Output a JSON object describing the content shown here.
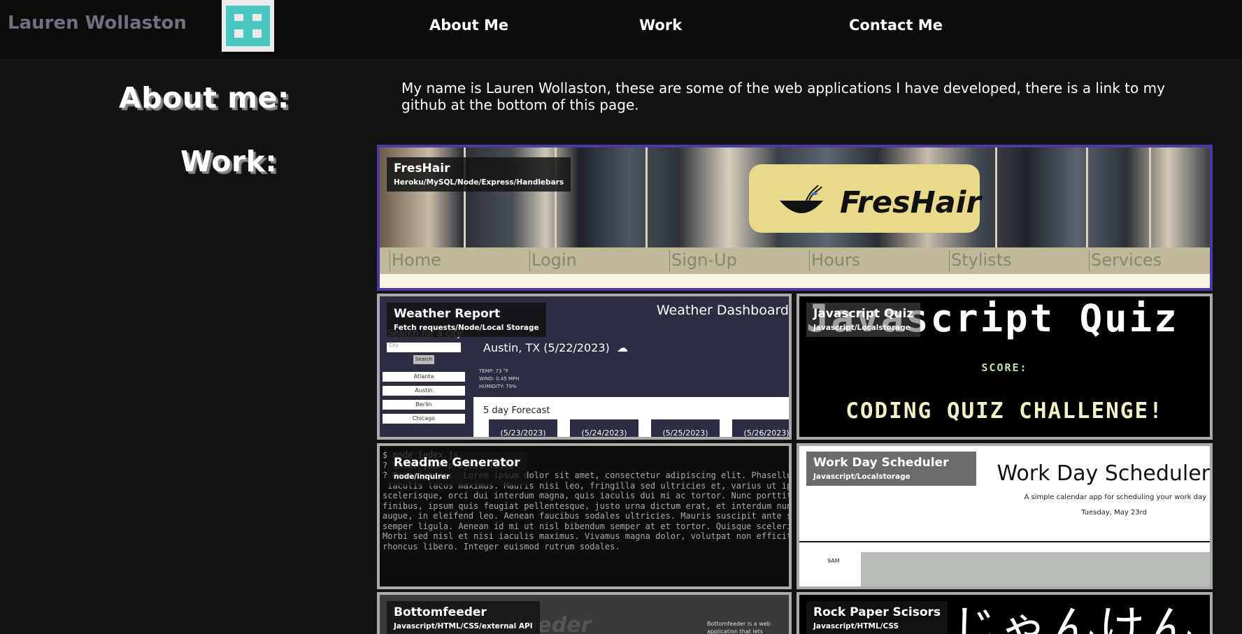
{
  "header": {
    "brand_name": "Lauren Wollaston",
    "nav": [
      {
        "label": "About Me"
      },
      {
        "label": "Work"
      },
      {
        "label": "Contact Me"
      }
    ]
  },
  "about": {
    "heading": "About me:",
    "text": "My name is Lauren Wollaston, these are some of the web applications I have developed, there is a link to my github at the bottom of this page."
  },
  "work": {
    "heading": "Work:",
    "projects": [
      {
        "title": "FresHair",
        "tech": "Heroku/MySQL/Node/Express/Handlebars"
      },
      {
        "title": "Weather Report",
        "tech": "Fetch requests/Node/Local Storage"
      },
      {
        "title": "Javascript Quiz",
        "tech": "Javascript/Localstorage"
      },
      {
        "title": "Readme Generator",
        "tech": "node/inquirer"
      },
      {
        "title": "Work Day Scheduler",
        "tech": "Javascript/Localstorage"
      },
      {
        "title": "Bottomfeeder",
        "tech": "Javascript/HTML/CSS/external API"
      },
      {
        "title": "Rock Paper Scisors",
        "tech": "Javascript/HTML/CSS"
      }
    ]
  },
  "previews": {
    "freshair": {
      "logo_text": "FresHair",
      "nav": [
        "Home",
        "Login",
        "Sign-Up",
        "Hours",
        "Stylists",
        "Services"
      ]
    },
    "weather": {
      "dashboard_title": "Weather Dashboard",
      "search_label": "Search for a city:",
      "search_placeholder": "City",
      "search_button": "Search",
      "cities": [
        "Atlanta",
        "Austin",
        "Berlin",
        "Chicago"
      ],
      "current_city": "Austin, TX (5/22/2023)",
      "temp": "TEMP: 73 °F",
      "wind": "WIND: 0.45 MPH",
      "humidity": "HUMIDITY: 79%",
      "forecast_label": "5 day Forecast",
      "forecast_dates": [
        "(5/23/2023)",
        "(5/24/2023)",
        "(5/25/2023)",
        "(5/26/2023)"
      ]
    },
    "quiz": {
      "big_title": "Javascript Quiz",
      "score_label": "SCORE:",
      "challenge": "CODING QUIZ CHALLENGE!"
    },
    "readme": {
      "code": "$ node index.js\n? Enter your project Title\n? Description:  Lorem ipsum dolor sit amet, consectetur adipiscing elit. Phasellus\n iaculis lacus maximus. Mauris nisi leo, fringilla sed ultricies et, varius ut ipsum\nscelerisque, orci dui interdum magna, quis iaculis dui mi ac tortor. Nunc porttitor\nfinibus, ipsum quis feugiat pellentesque, justo urna dictum erat, et interdum nunc\naugue, in eleifend leo. Aenean faucibus sodales ultricies. Mauris suscipit ante sed\nsemper ligula. Aenean id mi ut nisl bibendum semper at et tortor. Quisque scelerisque\nMorbi sed nisl et nisi iaculis maximus. Vivamus magna dolor, volutpat non efficitur\nrhoncus libero. Integer euismod rutrum sodales."
    },
    "scheduler": {
      "title": "Work Day Scheduler",
      "subtitle": "A simple calendar app for scheduling your work day",
      "date": "Tuesday, May 23rd",
      "hour": "9AM"
    },
    "bottomfeeder": {
      "word": "Bottomfeeder",
      "desc": "Bottomfeeder is a web application that lets consumers browse..."
    },
    "rps": {
      "jp_text": "じゃんけん"
    }
  }
}
